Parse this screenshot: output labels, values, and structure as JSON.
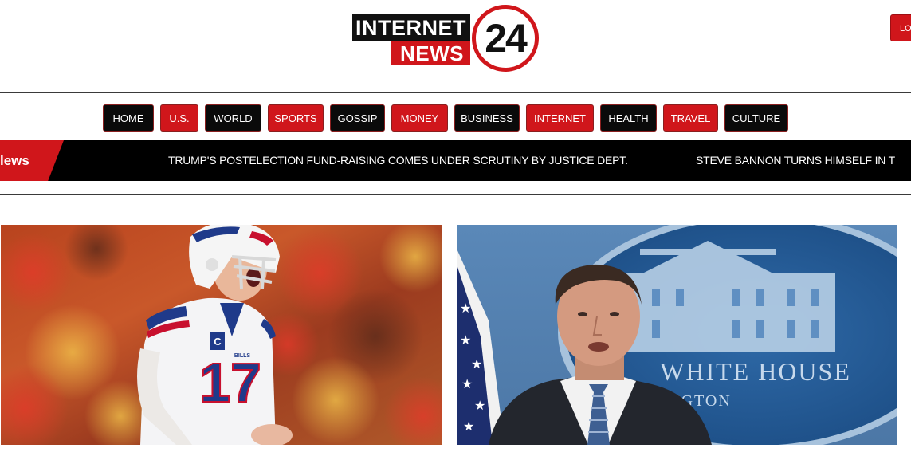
{
  "logo": {
    "line1": "INTERNET",
    "line2": "NEWS",
    "number": "24"
  },
  "header": {
    "login_label": "LO"
  },
  "nav": {
    "items": [
      {
        "label": "HOME",
        "style": "dark"
      },
      {
        "label": "U.S.",
        "style": "red"
      },
      {
        "label": "WORLD",
        "style": "dark"
      },
      {
        "label": "SPORTS",
        "style": "red"
      },
      {
        "label": "GOSSIP",
        "style": "dark"
      },
      {
        "label": "MONEY",
        "style": "red"
      },
      {
        "label": "BUSINESS",
        "style": "dark"
      },
      {
        "label": "INTERNET",
        "style": "red"
      },
      {
        "label": "HEALTH",
        "style": "dark"
      },
      {
        "label": "TRAVEL",
        "style": "red"
      },
      {
        "label": "CULTURE",
        "style": "dark"
      }
    ]
  },
  "ticker": {
    "label": "lews",
    "headlines": [
      "TRUMP'S POSTELECTION FUND-RAISING COMES UNDER SCRUTINY BY JUSTICE DEPT.",
      "STEVE BANNON TURNS HIMSELF IN T"
    ]
  },
  "articles": [
    {
      "image": "football-quarterback-photo",
      "jersey_number": "17",
      "helmet_text": "BILLS"
    },
    {
      "image": "white-house-briefing-photo",
      "sign_text": "WHITE HOUSE",
      "sign_subtext": "NGTON"
    }
  ],
  "colors": {
    "brand_red": "#d0161b",
    "nav_dark": "#0a0a0a",
    "ticker_bg": "#000000"
  }
}
